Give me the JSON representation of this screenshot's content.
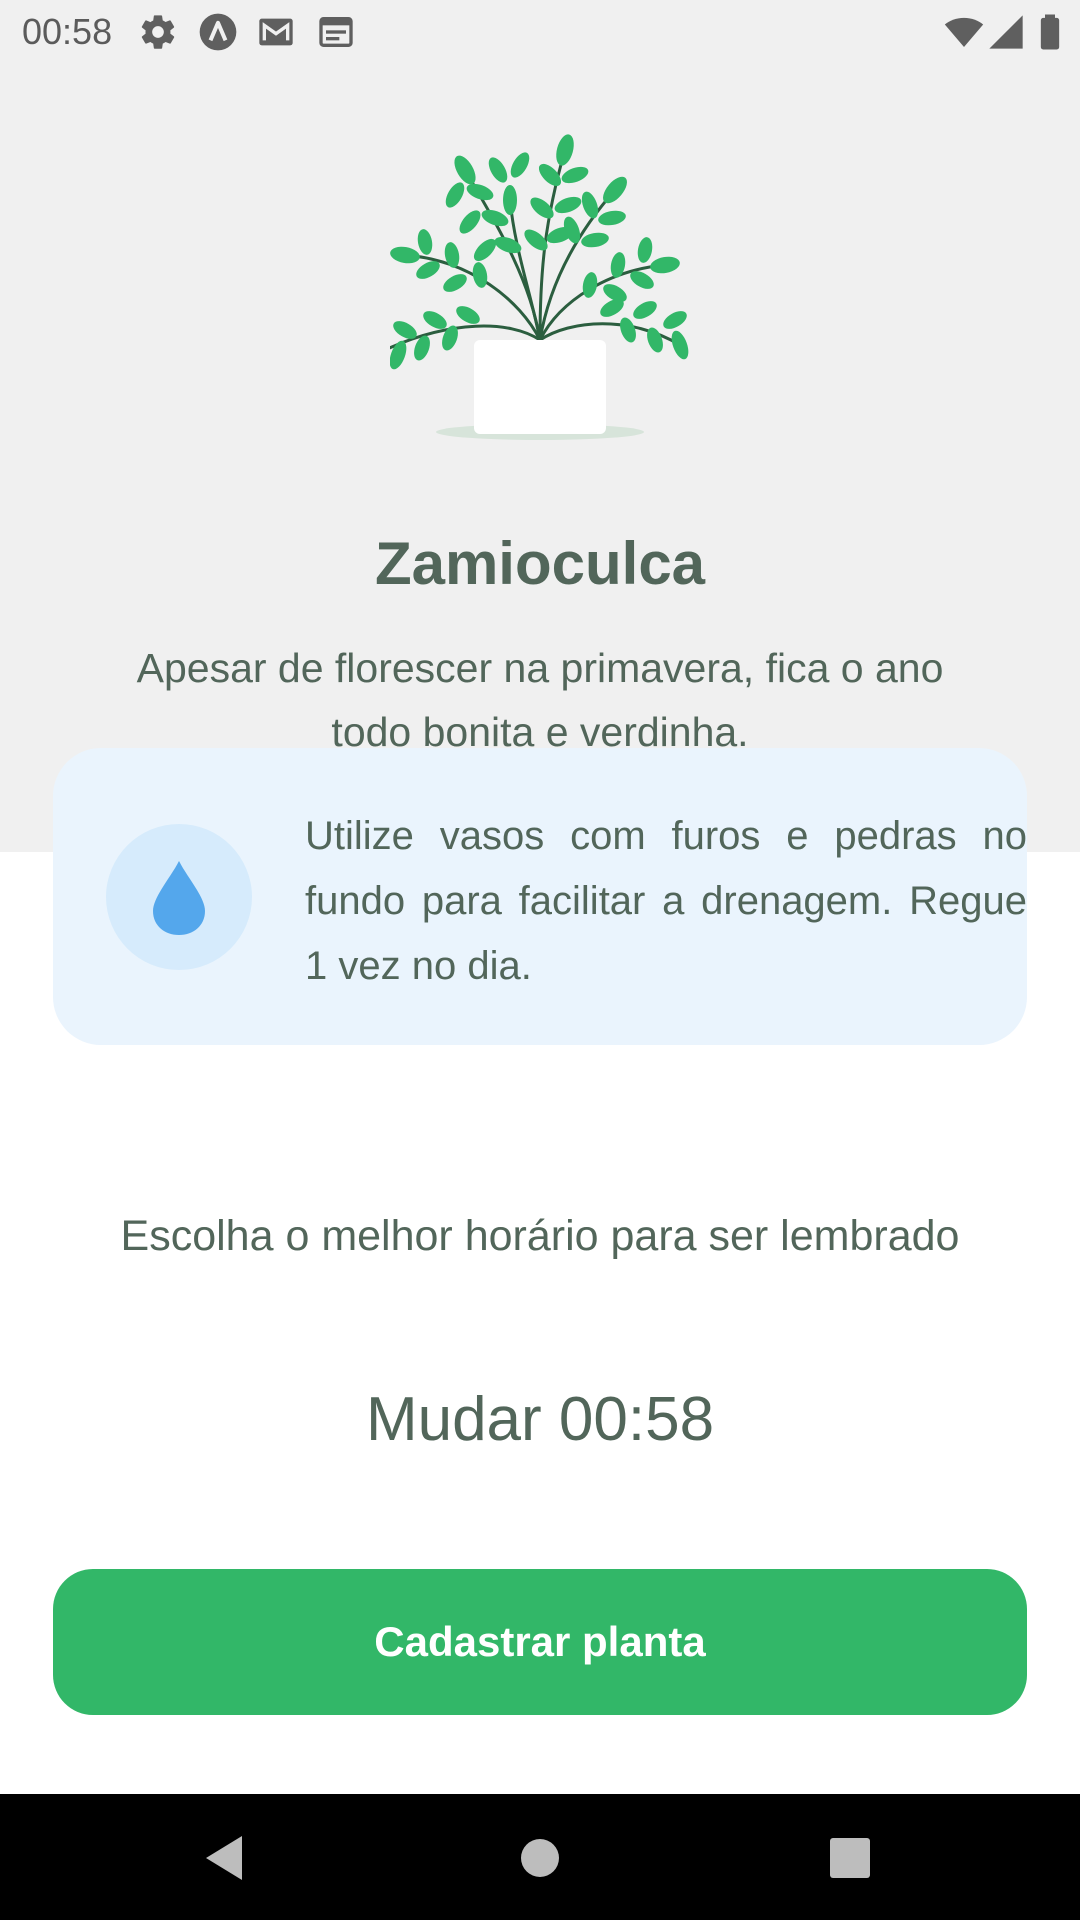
{
  "status_bar": {
    "time": "00:58",
    "icons": [
      "settings-icon",
      "app-a-icon",
      "gmail-icon",
      "calendar-icon",
      "wifi-icon",
      "signal-icon",
      "battery-icon"
    ]
  },
  "plant": {
    "name": "Zamioculca",
    "about": "Apesar de florescer na primavera, fica o ano todo bonita e verdinha.",
    "water_tip": "Utilize vasos com furos e pedras no fundo para facilitar a drenagem. Regue 1 vez no dia.",
    "illustration_icon": "potted-plant-illustration"
  },
  "reminder": {
    "label": "Escolha o melhor horário para ser lembrado",
    "change_time_label": "Mudar 00:58"
  },
  "actions": {
    "save_label": "Cadastrar planta"
  },
  "nav_bar": {
    "icons": [
      "back-icon",
      "home-icon",
      "recents-icon"
    ]
  },
  "colors": {
    "header_bg": "#f0f0f0",
    "heading_text": "#52665a",
    "tip_bg": "#eaf4fd",
    "tip_icon_bg": "#d6ebfc",
    "drop_blue": "#3d9be9",
    "primary_green": "#32b768"
  }
}
